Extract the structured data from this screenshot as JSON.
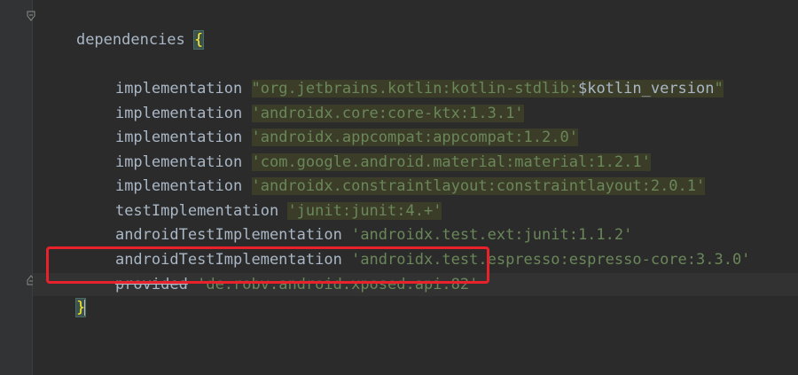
{
  "editor": {
    "block_keyword": "dependencies",
    "open_brace": "{",
    "close_brace": "}",
    "lines": [
      {
        "config": "implementation",
        "dep_prefix": "\"org.jetbrains.kotlin:kotlin-stdlib:",
        "dep_var": "$kotlin_version",
        "dep_suffix": "\""
      },
      {
        "config": "implementation",
        "dep": "'androidx.core:core-ktx:1.3.1'"
      },
      {
        "config": "implementation",
        "dep": "'androidx.appcompat:appcompat:1.2.0'"
      },
      {
        "config": "implementation",
        "dep": "'com.google.android.material:material:1.2.1'"
      },
      {
        "config": "implementation",
        "dep": "'androidx.constraintlayout:constraintlayout:2.0.1'"
      },
      {
        "config": "testImplementation",
        "dep": "'junit:junit:4.+'"
      },
      {
        "config": "androidTestImplementation",
        "dep": "'androidx.test.ext:junit:1.1.2'"
      },
      {
        "config": "androidTestImplementation",
        "dep": "'androidx.test.espresso:espresso-core:3.3.0'"
      },
      {
        "config": "provided",
        "dep": "'de.robv.android.xposed:api:82'"
      }
    ]
  },
  "colors": {
    "background": "#2b2b2b",
    "identifier": "#a9b7c6",
    "string": "#6a8759",
    "annotation_box": "#e8212b",
    "brace_match": "#ffef28"
  }
}
